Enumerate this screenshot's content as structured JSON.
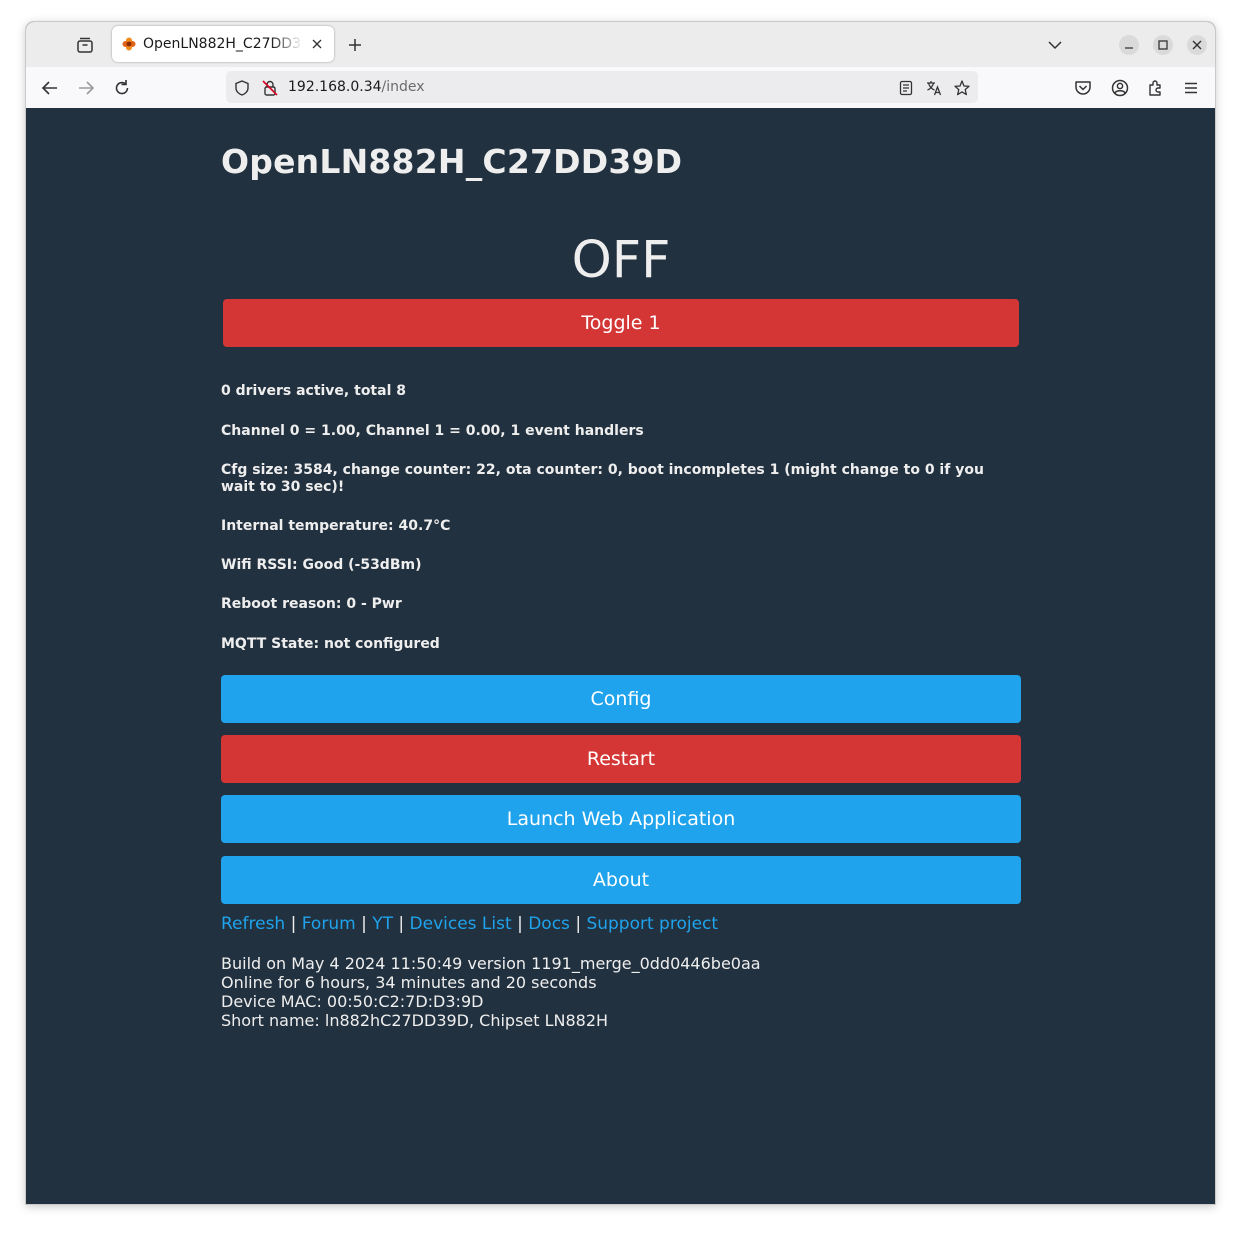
{
  "browser": {
    "tab_title": "OpenLN882H_C27DD39D",
    "url_host": "192.168.0.34",
    "url_path": "/index"
  },
  "page": {
    "title": "OpenLN882H_C27DD39D",
    "state": "OFF",
    "toggle_label": "Toggle 1",
    "info": [
      "0 drivers active, total 8",
      "Channel 0 = 1.00, Channel 1 = 0.00, 1 event handlers",
      "Cfg size: 3584, change counter: 22, ota counter: 0, boot incompletes 1 (might change to 0 if you wait to 30 sec)!",
      "Internal temperature: 40.7°C",
      "Wifi RSSI: Good (-53dBm)",
      "Reboot reason: 0 - Pwr",
      "MQTT State: not configured"
    ],
    "buttons": {
      "config": "Config",
      "restart": "Restart",
      "launch": "Launch Web Application",
      "about": "About"
    },
    "links": [
      "Refresh",
      "Forum",
      "YT",
      "Devices List",
      "Docs",
      "Support project"
    ],
    "link_separator": "|",
    "footer": [
      "Build on May 4 2024 11:50:49 version 1191_merge_0dd0446be0aa",
      "Online for 6 hours, 34 minutes and 20 seconds",
      "Device MAC: 00:50:C2:7D:D3:9D",
      "Short name: ln882hC27DD39D, Chipset LN882H"
    ]
  },
  "colors": {
    "background": "#22313f",
    "text": "#eeeeee",
    "red": "#d43535",
    "blue": "#1fa3ec"
  }
}
